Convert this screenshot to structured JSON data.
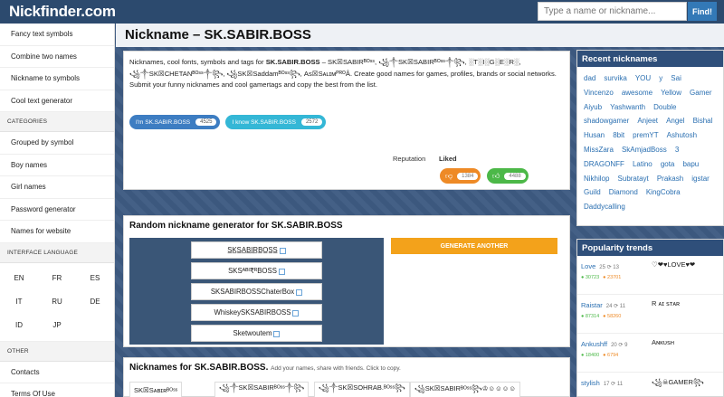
{
  "header": {
    "logo": "Nickfinder.com",
    "search_placeholder": "Type a name or nickname...",
    "find_label": "Find!"
  },
  "sidebar": {
    "items": [
      {
        "label": "Fancy text symbols"
      },
      {
        "label": "Combine two names"
      },
      {
        "label": "Nickname to symbols"
      },
      {
        "label": "Cool text generator"
      }
    ],
    "categories_heading": "Categories",
    "categories": [
      {
        "label": "Grouped by symbol"
      },
      {
        "label": "Boy names"
      },
      {
        "label": "Girl names"
      },
      {
        "label": "Password generator"
      },
      {
        "label": "Names for website"
      }
    ],
    "language_heading": "Interface language",
    "languages": [
      "EN",
      "FR",
      "ES",
      "IT",
      "RU",
      "DE",
      "ID",
      "JP"
    ],
    "other_heading": "Other",
    "other": [
      {
        "label": "Contacts"
      },
      {
        "label": "Terms Of Use"
      }
    ]
  },
  "main": {
    "title": "Nickname – SK.SABIR.BOSS",
    "intro_prefix": "Nicknames, cool fonts, symbols and tags for ",
    "intro_name": "SK.SABIR.BOSS",
    "intro_middle": " – SK☒SABIRᴮᴼˢˢ, ꧁༒SK☒SABIRᴮᴼˢˢ༒꧂, ░T░I░G░E░R░, ꧁༒SK☒CHETANᴮᴼˢˢ༒꧂, ꧁SK☒Saddamᴮᴼˢˢ꧂, As☒SᴀʟɪᴍᴾᴿᴼÂ. ",
    "intro_suffix": "Create good names for games, profiles, brands or social networks. Submit your funny nicknames and cool gamertags and copy the best from the list.",
    "pill_a": {
      "label": "I'm SK.SABIR.BOSS",
      "count": "4525"
    },
    "pill_b": {
      "label": "I know SK.SABIR.BOSS",
      "count": "2572"
    },
    "reputation_label": "Reputation",
    "liked_label": "Liked",
    "vote_down": {
      "icon": "thumb-down-icon",
      "count": "1384"
    },
    "vote_up": {
      "icon": "thumb-up-icon",
      "count": "4488"
    },
    "colors": {
      "accent": "#3d7dc2",
      "orange": "#f3a21b",
      "green": "#4cb848"
    }
  },
  "generator": {
    "title": "Random nickname generator for SK.SABIR.BOSS",
    "results": [
      "S̲K̲S̲A̲B̲I̲R̲B̲O̲S̲S̲",
      "SKSᴬᴮᴵ₹ᴿBOSS",
      "SKSABIRBOSSChaterBox",
      "WhiskeySKSABIRBOSS",
      "Sketwoutem"
    ],
    "button_label": "Generate another"
  },
  "nicknames": {
    "title": "Nicknames for SK.SABIR.BOSS.",
    "subtitle": "Add your names, share with friends. Click to copy.",
    "items": [
      "SK☒Sᴀʙɪʀᴮᴼˢˢ",
      "꧁༒SK☒SABIRᴮᴼˢˢ༒꧂",
      "꧁༒SK☒SOHRAB.ᴮᴼˢˢ꧂",
      "꧁SK☒SABIRᴮᴼˢˢ꧂♔☺☺☺☺"
    ]
  },
  "recent": {
    "heading": "Recent nicknames",
    "tags": [
      "dad",
      "survika",
      "YOU",
      "y",
      "Sai",
      "Vincenzo",
      "awesome",
      "Yellow",
      "Gamer",
      "Aiyub",
      "Yashwanth",
      "Double",
      "shadowgamer",
      "Anjeet",
      "Angel",
      "Bishal",
      "Husan",
      "8bit",
      "premYT",
      "Ashutosh",
      "MissZara",
      "SkAmjadBoss",
      "3",
      "DRAGONFF",
      "Latino",
      "gota",
      "bapu",
      "Nikhilop",
      "Subratayt",
      "Prakash",
      "igstar",
      "Guild",
      "Diamond",
      "KingCobra",
      "Daddycalling"
    ]
  },
  "trends": {
    "heading": "Popularity trends",
    "items": [
      {
        "name": "Love",
        "meta": "25 ⟳ 13",
        "deco": "♡❤︎♥LOVE♥❤︎",
        "up": "30723",
        "down": "23701"
      },
      {
        "name": "Raistar",
        "meta": "24 ⟳ 11",
        "deco": "R ᴀɪ ꜱᴛᴀʀ",
        "up": "87314",
        "down": "58260"
      },
      {
        "name": "Ankushff",
        "meta": "20 ⟳ 9",
        "deco": "Aɴᴋᴜꜱʜ",
        "up": "18400",
        "down": "6794"
      },
      {
        "name": "stylish",
        "meta": "17 ⟳ 11",
        "deco": "꧁☠︎GAMER꧂",
        "up": "",
        "down": ""
      }
    ]
  }
}
